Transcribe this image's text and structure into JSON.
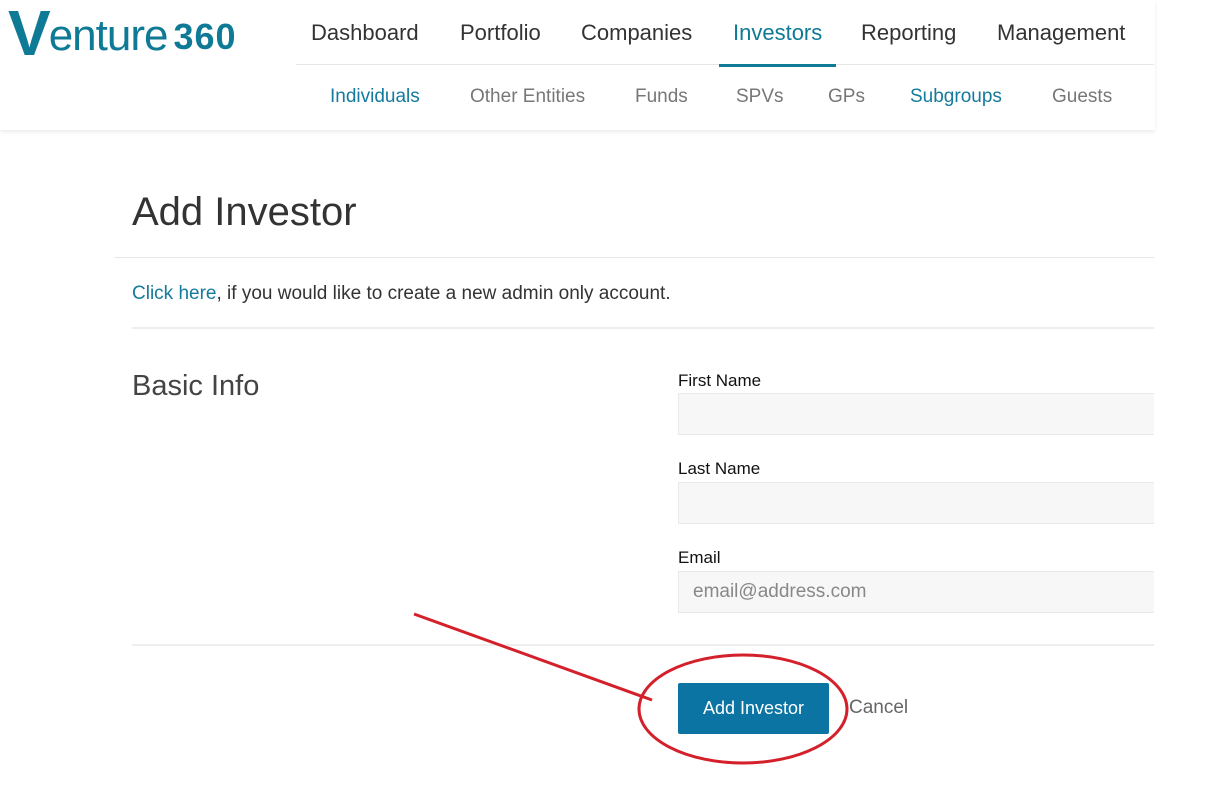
{
  "brand": {
    "logo_letter": "V",
    "logo_word": "enture",
    "logo_number": "360",
    "color": "#0e7a96"
  },
  "primary_nav": {
    "items": [
      {
        "label": "Dashboard",
        "active": false
      },
      {
        "label": "Portfolio",
        "active": false
      },
      {
        "label": "Companies",
        "active": false
      },
      {
        "label": "Investors",
        "active": true
      },
      {
        "label": "Reporting",
        "active": false
      },
      {
        "label": "Management",
        "active": false
      }
    ]
  },
  "secondary_nav": {
    "items": [
      {
        "label": "Individuals",
        "linked": true
      },
      {
        "label": "Other Entities",
        "linked": false
      },
      {
        "label": "Funds",
        "linked": false
      },
      {
        "label": "SPVs",
        "linked": false
      },
      {
        "label": "GPs",
        "linked": false
      },
      {
        "label": "Subgroups",
        "linked": true
      },
      {
        "label": "Guests",
        "linked": false
      }
    ]
  },
  "page": {
    "title": "Add Investor",
    "admin_link_text": "Click here",
    "admin_note_rest": ", if you would like to create a new admin only account."
  },
  "basic_info": {
    "section_title": "Basic Info",
    "first_name": {
      "label": "First Name",
      "value": "",
      "placeholder": ""
    },
    "last_name": {
      "label": "Last Name",
      "value": "",
      "placeholder": ""
    },
    "email": {
      "label": "Email",
      "value": "",
      "placeholder": "email@address.com"
    }
  },
  "actions": {
    "submit_label": "Add Investor",
    "cancel_label": "Cancel"
  },
  "colors": {
    "accent": "#0b74a3",
    "link": "#157a9c",
    "annotation": "#d4202a"
  }
}
